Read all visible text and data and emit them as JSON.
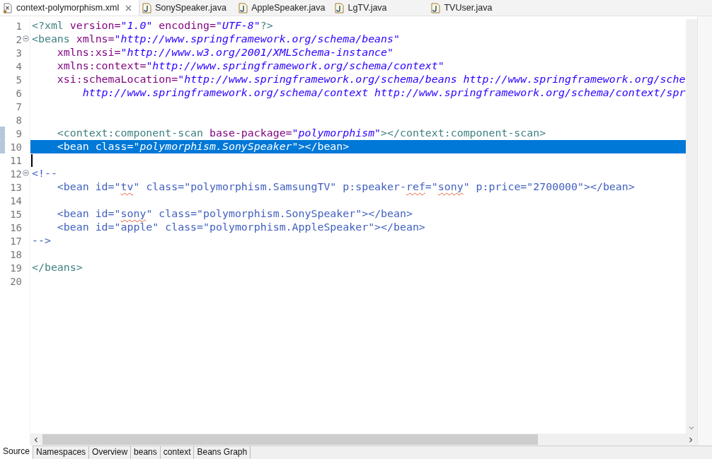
{
  "editor_tabs": [
    {
      "label": "context-polymorphism.xml",
      "kind": "xml",
      "selected": true
    },
    {
      "label": "SonySpeaker.java",
      "kind": "java",
      "selected": false
    },
    {
      "label": "AppleSpeaker.java",
      "kind": "java",
      "selected": false
    },
    {
      "label": "LgTV.java",
      "kind": "java",
      "selected": false
    },
    {
      "label": "TVUser.java",
      "kind": "java",
      "selected": false
    }
  ],
  "lines": [
    {
      "number": "1",
      "segments": [
        {
          "kind": "tag",
          "text": "<?xml"
        },
        {
          "kind": "attr",
          "text": " version="
        },
        {
          "kind": "string",
          "text": "\"1.0\""
        },
        {
          "kind": "attr",
          "text": " encoding="
        },
        {
          "kind": "string",
          "text": "\"UTF-8\""
        },
        {
          "kind": "tag",
          "text": "?>"
        }
      ]
    },
    {
      "number": "2",
      "folding": true,
      "segments": [
        {
          "kind": "tag",
          "text": "<beans"
        },
        {
          "kind": "attr",
          "text": " xmlns="
        },
        {
          "kind": "string",
          "text": "\"http://www.springframework.org/schema/beans\""
        }
      ]
    },
    {
      "number": "3",
      "segments": [
        {
          "kind": "attr",
          "text": "    xmlns:xsi="
        },
        {
          "kind": "string",
          "text": "\"http://www.w3.org/2001/XMLSchema-instance\""
        }
      ]
    },
    {
      "number": "4",
      "segments": [
        {
          "kind": "attr",
          "text": "    xmlns:context="
        },
        {
          "kind": "string",
          "text": "\"http://www.springframework.org/schema/context\""
        }
      ]
    },
    {
      "number": "5",
      "segments": [
        {
          "kind": "attr",
          "text": "    xsi:schemaLocation="
        },
        {
          "kind": "string",
          "text": "\"http://www.springframework.org/schema/beans http://www.springframework.org/sche"
        }
      ]
    },
    {
      "number": "6",
      "segments": [
        {
          "kind": "string",
          "text": "        http://www.springframework.org/schema/context http://www.springframework.org/schema/context/spr"
        }
      ]
    },
    {
      "number": "7"
    },
    {
      "number": "8"
    },
    {
      "number": "9",
      "changed": true,
      "segments": [
        {
          "kind": "tag",
          "text": "    <context:component-scan"
        },
        {
          "kind": "attr",
          "text": " base-package="
        },
        {
          "kind": "string",
          "text": "\"polymorphism\""
        },
        {
          "kind": "tag",
          "text": "></context:component-scan>"
        }
      ]
    },
    {
      "number": "10",
      "changed": true,
      "selected": true,
      "segments": [
        {
          "kind": "tag",
          "text": "    <bean"
        },
        {
          "kind": "attr",
          "text": " class="
        },
        {
          "kind": "string",
          "text": "\"polymorphism.SonySpeaker\""
        },
        {
          "kind": "tag",
          "text": "></bean>"
        }
      ]
    },
    {
      "number": "11",
      "cursor": true
    },
    {
      "number": "12",
      "folding": true,
      "segments": [
        {
          "kind": "comment",
          "text": "<!--"
        }
      ]
    },
    {
      "number": "13",
      "segments": [
        {
          "kind": "comment",
          "text": "    <bean id=\""
        },
        {
          "kind": "misspelled",
          "text": "tv"
        },
        {
          "kind": "comment",
          "text": "\" class=\"polymorphism.SamsungTV\" p:speaker-"
        },
        {
          "kind": "misspelled",
          "text": "ref"
        },
        {
          "kind": "comment",
          "text": "=\""
        },
        {
          "kind": "misspelled",
          "text": "sony"
        },
        {
          "kind": "comment",
          "text": "\" p:price=\"2700000\"></bean>"
        }
      ]
    },
    {
      "number": "14"
    },
    {
      "number": "15",
      "segments": [
        {
          "kind": "comment",
          "text": "    <bean id=\""
        },
        {
          "kind": "misspelled",
          "text": "sony"
        },
        {
          "kind": "comment",
          "text": "\" class=\"polymorphism.SonySpeaker\"></bean>"
        }
      ]
    },
    {
      "number": "16",
      "segments": [
        {
          "kind": "comment",
          "text": "    <bean id=\"apple\" class=\"polymorphism.AppleSpeaker\"></bean>"
        }
      ]
    },
    {
      "number": "17",
      "segments": [
        {
          "kind": "comment",
          "text": "-->"
        }
      ]
    },
    {
      "number": "18"
    },
    {
      "number": "19",
      "segments": [
        {
          "kind": "tag",
          "text": "</beans>"
        }
      ]
    },
    {
      "number": "20"
    }
  ],
  "bottom_tabs": [
    {
      "label": "Source",
      "selected": true
    },
    {
      "label": "Namespaces",
      "selected": false
    },
    {
      "label": "Overview",
      "selected": false
    },
    {
      "label": "beans",
      "selected": false
    },
    {
      "label": "context",
      "selected": false
    },
    {
      "label": "Beans Graph",
      "selected": false
    }
  ]
}
